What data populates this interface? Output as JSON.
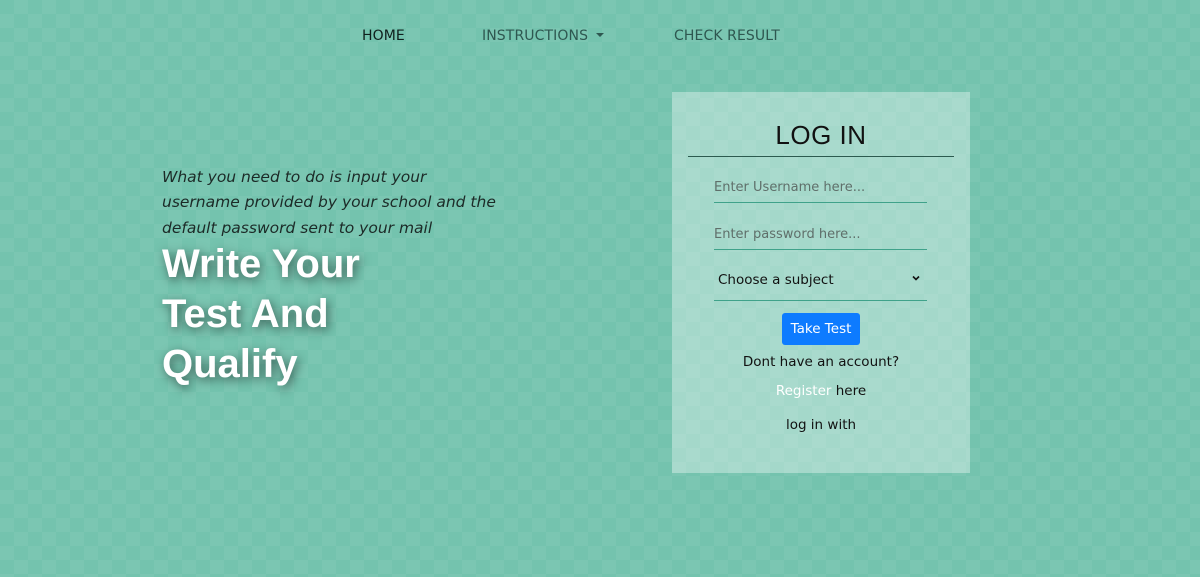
{
  "nav": {
    "home": "HOME",
    "instructions": "INSTRUCTIONS",
    "check_result": "CHECK RESULT"
  },
  "intro": {
    "text": "What you need to do is input your username provided by your school and the default password sent to your mail"
  },
  "hero": {
    "line1": "Write Your",
    "line2": "Test And",
    "line3": "Qualify"
  },
  "login": {
    "title": "LOG IN",
    "username_placeholder": "Enter Username here...",
    "password_placeholder": "Enter password here...",
    "subject_selected": "Choose a subject",
    "button": "Take Test",
    "no_account": "Dont have an account?",
    "register_link": "Register",
    "register_suffix": " here",
    "login_with": "log in with"
  },
  "colors": {
    "background": "#74c3ae",
    "button": "#0d7bff",
    "underline": "#3fa28a"
  },
  "icons": {
    "instructions_caret": "caret-down-icon",
    "select_chevron": "chevron-down-icon"
  }
}
